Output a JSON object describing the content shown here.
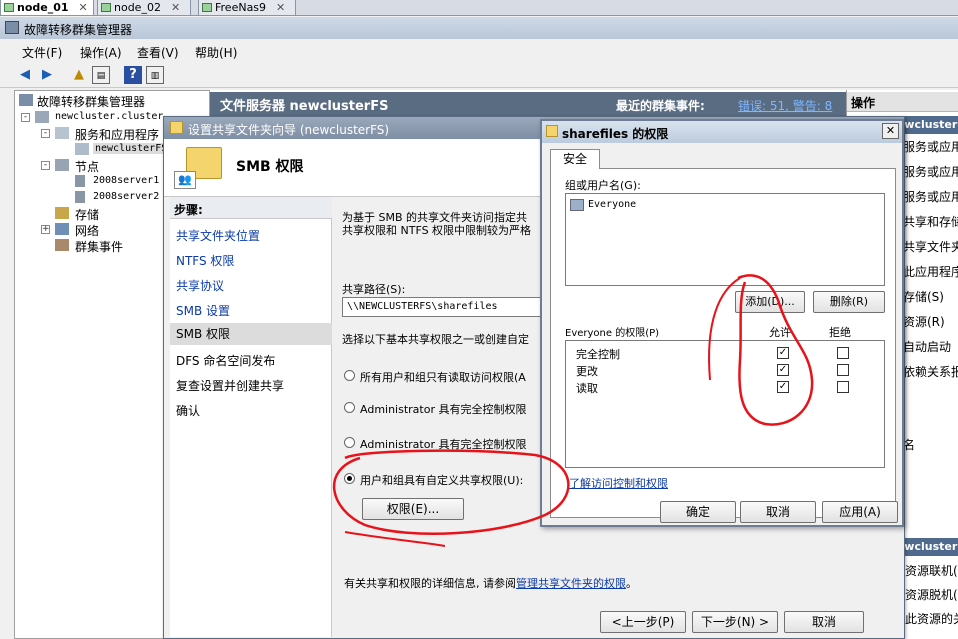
{
  "vm_tabs": [
    {
      "label": "node_01",
      "active": true
    },
    {
      "label": "node_02",
      "active": false
    },
    {
      "label": "FreeNas9",
      "active": false
    }
  ],
  "app": {
    "title": "故障转移群集管理器"
  },
  "menu": [
    "文件(F)",
    "操作(A)",
    "查看(V)",
    "帮助(H)"
  ],
  "tree": {
    "root": "故障转移群集管理器",
    "cluster": "newcluster.cluster",
    "services": "服务和应用程序",
    "service_item": "newclusterFS",
    "nodes": "节点",
    "node1": "2008server1",
    "node2": "2008server2",
    "storage": "存储",
    "network": "网络",
    "events": "群集事件"
  },
  "center_header": {
    "title": "文件服务器 newclusterFS",
    "events_label": "最近的群集事件:",
    "events_value": "错误: 51, 警告: 8"
  },
  "actions": {
    "header": "操作",
    "section1": "newclusterFS",
    "items1": [
      "服务或应用",
      "服务或应用",
      "服务或应用",
      "共享和存储",
      "共享文件夹",
      "此应用程序",
      "存储(S)",
      "资源(R)",
      "自动启动",
      "依赖关系报"
    ],
    "item_name": "名",
    "section2": "newcluster",
    "items2": [
      "使该资源联机(",
      "使该资源脱机(",
      "显示此资源的关"
    ]
  },
  "wizard": {
    "title": "设置共享文件夹向导 (newclusterFS)",
    "header": "SMB 权限",
    "steps_label": "步骤:",
    "steps": [
      "共享文件夹位置",
      "NTFS 权限",
      "共享协议",
      "SMB 设置",
      "SMB 权限",
      "DFS 命名空间发布",
      "复查设置并创建共享",
      "确认"
    ],
    "intro_line1": "为基于 SMB 的共享文件夹访问指定共",
    "intro_line2": "共享权限和 NTFS 权限中限制较为严格",
    "share_path_label": "共享路径(S):",
    "share_path_value": "\\\\NEWCLUSTERFS\\sharefiles",
    "choose_label": "选择以下基本共享权限之一或创建自定",
    "options": [
      {
        "label": "所有用户和组只有读取访问权限(A",
        "selected": false
      },
      {
        "label": "Administrator 具有完全控制权限",
        "selected": false
      },
      {
        "label": "Administrator 具有完全控制权限",
        "selected": false
      },
      {
        "label": "用户和组具有自定义共享权限(U):",
        "selected": true
      }
    ],
    "permissions_button": "权限(E)...",
    "footer_text": "有关共享和权限的详细信息, 请参阅",
    "footer_link": "管理共享文件夹的权限",
    "footer_end": "。",
    "back_button": "<上一步(P)",
    "next_button": "下一步(N) >",
    "cancel_button": "取消"
  },
  "perm_dialog": {
    "title": "sharefiles 的权限",
    "tab": "安全",
    "group_label": "组或用户名(G):",
    "users": [
      "Everyone"
    ],
    "add_button": "添加(D)...",
    "remove_button": "删除(R)",
    "perm_label": "Everyone 的权限(P)",
    "allow_header": "允许",
    "deny_header": "拒绝",
    "permissions": [
      {
        "name": "完全控制",
        "allow": true,
        "deny": false
      },
      {
        "name": "更改",
        "allow": true,
        "deny": false
      },
      {
        "name": "读取",
        "allow": true,
        "deny": false
      }
    ],
    "learn_link": "了解访问控制和权限",
    "ok_button": "确定",
    "cancel_button": "取消",
    "apply_button": "应用(A)"
  },
  "colors": {
    "annotation": "#e8131a",
    "link": "#0b3aa6",
    "header_bg": "#5a6c82"
  }
}
